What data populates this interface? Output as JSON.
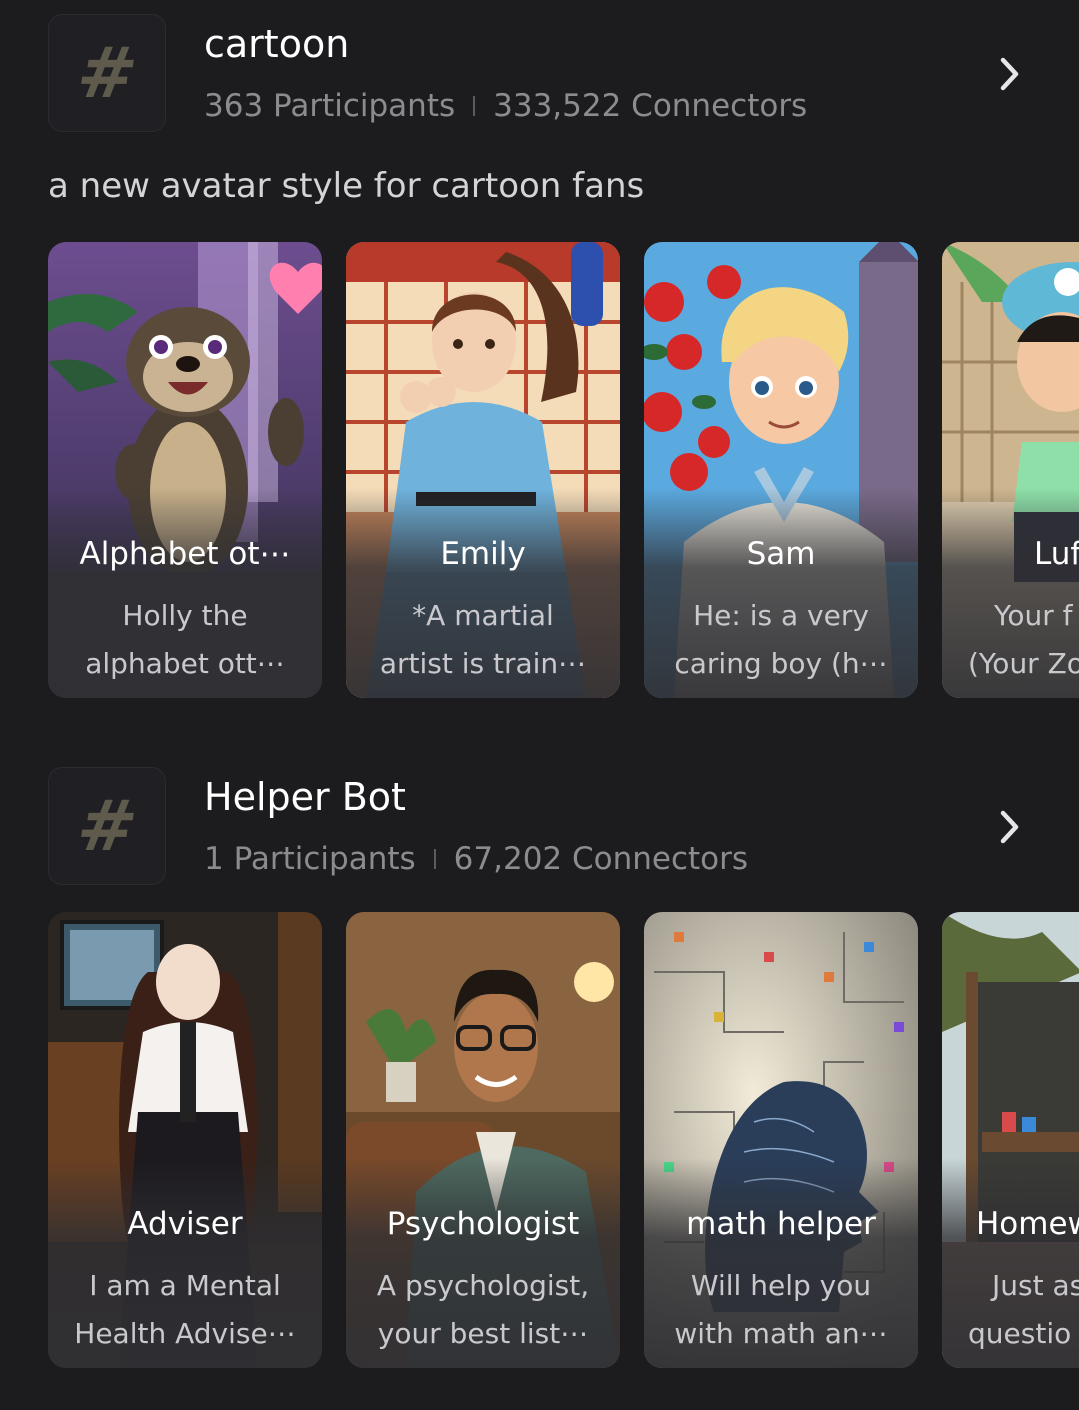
{
  "sections": [
    {
      "title": "cartoon",
      "participants": "363 Participants",
      "connectors": "333,522 Connectors",
      "description": "a new avatar style for cartoon fans",
      "cards": [
        {
          "name": "Alphabet ot⋯",
          "desc1": "Holly the",
          "desc2": "alphabet ott⋯"
        },
        {
          "name": "Emily",
          "desc1": "*A martial",
          "desc2": "artist is train⋯"
        },
        {
          "name": "Sam",
          "desc1": "He: is a very",
          "desc2": "caring boy (h⋯"
        },
        {
          "name": "Luf",
          "desc1": "Your f",
          "desc2": "(Your Zo"
        }
      ]
    },
    {
      "title": "Helper Bot",
      "participants": "1 Participants",
      "connectors": "67,202 Connectors",
      "cards": [
        {
          "name": "Adviser",
          "desc1": "I am a Mental",
          "desc2": "Health Advise⋯"
        },
        {
          "name": "Psychologist",
          "desc1": "A psychologist,",
          "desc2": "your best list⋯"
        },
        {
          "name": "math helper",
          "desc1": "Will help you",
          "desc2": "with math an⋯"
        },
        {
          "name": "Homew",
          "desc1": "Just as",
          "desc2": "questio"
        }
      ]
    }
  ],
  "icons": {
    "hash": "#",
    "chevron": "chevron-right-icon"
  }
}
